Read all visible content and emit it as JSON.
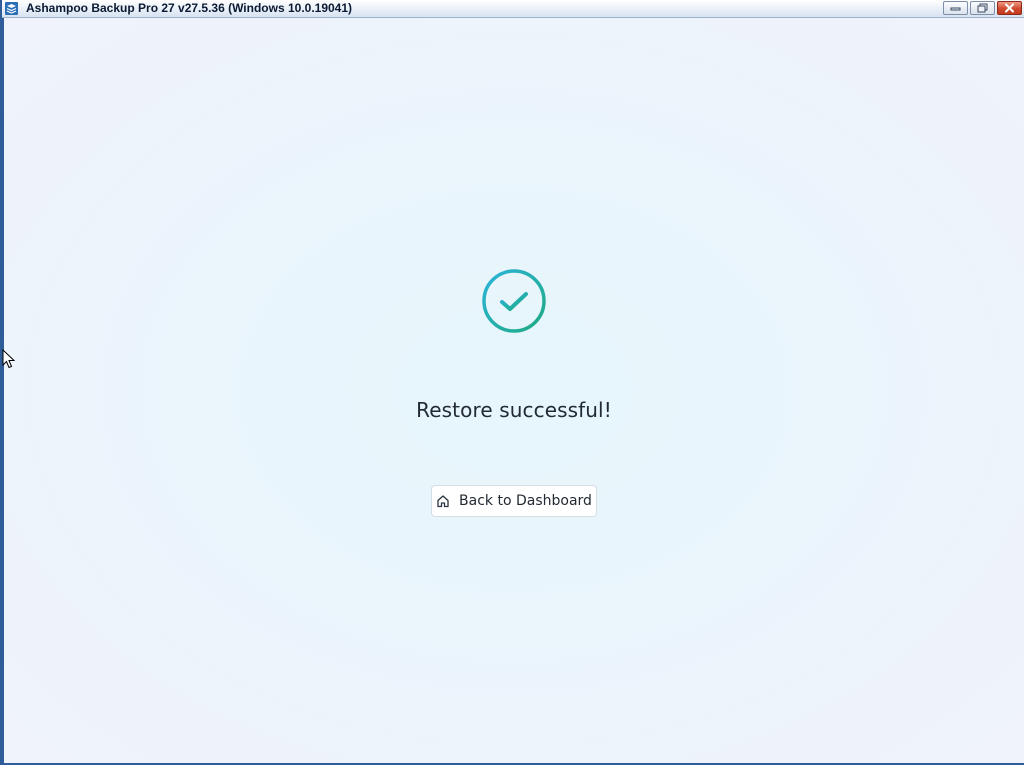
{
  "window": {
    "title": "Ashampoo Backup Pro 27 v27.5.36 (Windows 10.0.19041)",
    "icon": "app-stack-icon",
    "controls": {
      "minimize": "minimize-icon",
      "restore": "restore-icon",
      "close": "close-icon"
    }
  },
  "main": {
    "status_icon": "check-circle-icon",
    "message": "Restore successful!",
    "back_button": {
      "label": "Back to Dashboard",
      "icon": "home-icon"
    }
  },
  "colors": {
    "accent_start": "#2bb3d9",
    "accent_end": "#1fab83",
    "window_frame": "#2f5d9a",
    "text": "#222a33"
  }
}
